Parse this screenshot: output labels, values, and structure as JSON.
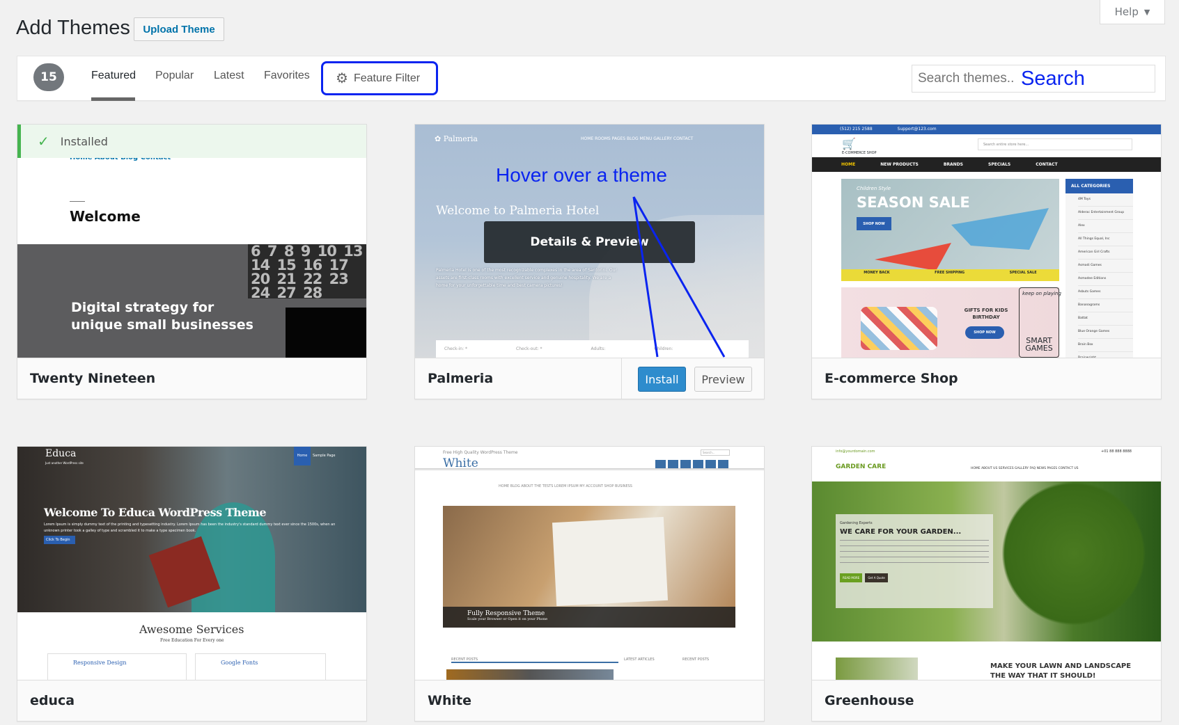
{
  "header": {
    "title": "Add Themes",
    "upload_label": "Upload Theme",
    "help_label": "Help"
  },
  "filter_bar": {
    "count": "15",
    "tabs": [
      {
        "label": "Featured",
        "active": true
      },
      {
        "label": "Popular"
      },
      {
        "label": "Latest"
      },
      {
        "label": "Favorites"
      }
    ],
    "feature_filter_label": "Feature Filter",
    "search_placeholder": "Search themes...",
    "search_annotation": "Search"
  },
  "annotation": {
    "hover_text": "Hover over a theme",
    "color": "#0a24f0"
  },
  "themes": [
    {
      "name": "Twenty Nineteen",
      "installed_label": "Installed",
      "preview": {
        "nav": "Home  About  Blog  Contact",
        "welcome": "Welcome",
        "headline1": "Digital strategy for",
        "headline2": "unique small businesses",
        "calendar": "6 7 8 9 10 13 14 15 16 17 20 21 22 23 24 27 28"
      }
    },
    {
      "name": "Palmeria",
      "overlay_label": "Details & Preview",
      "install_label": "Install",
      "preview_label": "Preview",
      "preview": {
        "logo": "Palmeria",
        "nav": "HOME   ROOMS   PAGES   BLOG   MENU   GALLERY   CONTACT",
        "welcome": "Welcome to Palmeria Hotel",
        "body": "Palmeria Hotel is one of the most recognizable complexes in the area of Santorini. Our assets are first-class rooms with excellent service and genuine hospitality. We are a home for your unforgettable time and best camera pictures!",
        "fields": [
          "Check-in: *",
          "Check-out: *",
          "Adults:",
          "Children:"
        ]
      }
    },
    {
      "name": "E-commerce Shop",
      "preview": {
        "phone": "(512) 215 2588",
        "email": "Support@123.com",
        "logo": "E-COMMERCE SHOP",
        "search": "Search entire store here...",
        "nav": [
          "HOME",
          "NEW PRODUCTS",
          "BRANDS",
          "SPECIALS",
          "CONTACT"
        ],
        "kicker": "Children Style",
        "sale": "SEASON SALE",
        "shop_now": "SHOP NOW",
        "strip": [
          "MONEY BACK",
          "FREE SHIPPING",
          "SPECIAL SALE"
        ],
        "gifts": "GIFTS FOR KIDS BIRTHDAY",
        "keep": "keep on playing",
        "smart": "SMART GAMES",
        "categories_title": "ALL CATEGORIES",
        "categories": [
          "4M Toys",
          "Alderac Entertainment Group",
          "Alex",
          "All Things Equal, Inc",
          "American Girl Crafts",
          "Asmodi Games",
          "Asmodee Editions",
          "Asbuts Games",
          "Bananagrams",
          "Battat",
          "Blue Orange Games",
          "Brain Box",
          "Brainwright"
        ]
      }
    },
    {
      "name": "educa",
      "preview": {
        "logo": "Educa",
        "tagline": "Just another WordPress site",
        "menu": [
          "Home",
          "Sample Page"
        ],
        "headline": "Welcome To Educa WordPress Theme",
        "body": "Lorem Ipsum is simply dummy text of the printing and typesetting industry. Lorem Ipsum has been the industry's standard dummy text ever since the 1500s, when an unknown printer took a galley of type and scrambled it to make a type specimen book.",
        "cta": "Click To Begin",
        "services": "Awesome Services",
        "services_sub": "Free Education For Every one",
        "features": [
          "Responsive Design",
          "Google Fonts"
        ]
      }
    },
    {
      "name": "White",
      "preview": {
        "kicker": "Free High Quality WordPress Theme",
        "logo": "White",
        "search": "Search...",
        "nav": "HOME   BLOG   ABOUT THE TESTS   LOREM IPSUM   MY ACCOUNT   SHOP   BUSINESS",
        "slide_title": "Fully Responsive Theme",
        "slide_sub": "Scale your Browser or Open it on your Phone",
        "widgets": [
          "RECENT POSTS",
          "LATEST ARTICLES",
          "RECENT POSTS"
        ]
      }
    },
    {
      "name": "Greenhouse",
      "preview": {
        "email": "info@yourdomain.com",
        "phone": "+01 88 888 8888",
        "logo": "GARDEN CARE",
        "nav": "HOME   ABOUT US   SERVICES   GALLERY   FAQ   NEWS   PAGES   CONTACT US",
        "kicker": "Gardening Experts",
        "headline": "WE CARE FOR YOUR GARDEN...",
        "buttons": [
          "READ MORE",
          "Get A Quote"
        ],
        "tagline1": "MAKE YOUR LAWN AND LANDSCAPE",
        "tagline2": "THE WAY THAT IT SHOULD!"
      }
    }
  ]
}
